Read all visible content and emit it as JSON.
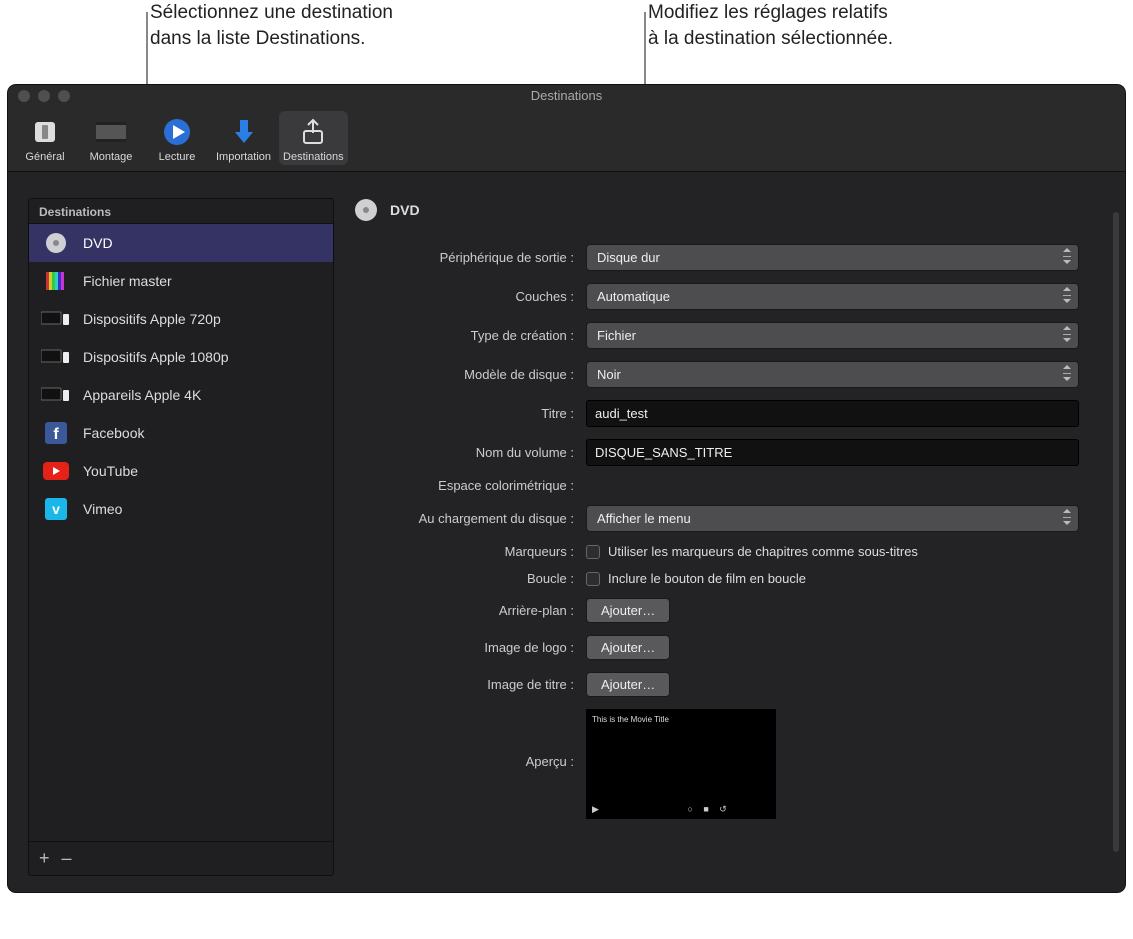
{
  "callouts": {
    "left_line1": "Sélectionnez une destination",
    "left_line2": "dans la liste Destinations.",
    "right_line1": "Modifiez les réglages relatifs",
    "right_line2": "à la destination sélectionnée."
  },
  "window": {
    "title": "Destinations"
  },
  "toolbar": {
    "items": [
      {
        "label": "Général",
        "icon": "switch-icon"
      },
      {
        "label": "Montage",
        "icon": "filmstrip-icon"
      },
      {
        "label": "Lecture",
        "icon": "play-icon"
      },
      {
        "label": "Importation",
        "icon": "download-icon"
      },
      {
        "label": "Destinations",
        "icon": "share-icon",
        "selected": true
      }
    ]
  },
  "sidebar": {
    "header": "Destinations",
    "items": [
      {
        "label": "DVD",
        "icon": "disc-icon",
        "selected": true
      },
      {
        "label": "Fichier master",
        "icon": "colorbars-icon"
      },
      {
        "label": "Dispositifs Apple 720p",
        "icon": "devices-icon"
      },
      {
        "label": "Dispositifs Apple 1080p",
        "icon": "devices-icon"
      },
      {
        "label": "Appareils Apple 4K",
        "icon": "devices-icon"
      },
      {
        "label": "Facebook",
        "icon": "facebook-icon"
      },
      {
        "label": "YouTube",
        "icon": "youtube-icon"
      },
      {
        "label": "Vimeo",
        "icon": "vimeo-icon"
      }
    ],
    "add": "+",
    "remove": "–"
  },
  "detail": {
    "header": "DVD",
    "labels": {
      "output_device": "Périphérique de sortie :",
      "layers": "Couches :",
      "build_type": "Type de création :",
      "disc_template": "Modèle de disque :",
      "title": "Titre :",
      "volume_name": "Nom du volume :",
      "color_space": "Espace colorimétrique :",
      "on_load": "Au chargement du disque :",
      "markers": "Marqueurs :",
      "loop": "Boucle :",
      "background": "Arrière-plan :",
      "logo": "Image de logo :",
      "title_image": "Image de titre :",
      "preview": "Aperçu :"
    },
    "values": {
      "output_device": "Disque dur",
      "layers": "Automatique",
      "build_type": "Fichier",
      "disc_template": "Noir",
      "title": "audi_test",
      "volume_name": "DISQUE_SANS_TITRE",
      "color_space": "",
      "on_load": "Afficher le menu",
      "markers_checkbox": "Utiliser les marqueurs de chapitres comme sous-titres",
      "loop_checkbox": "Inclure le bouton de film en boucle",
      "add_button": "Ajouter…",
      "preview_caption": "This is the Movie Title"
    }
  }
}
